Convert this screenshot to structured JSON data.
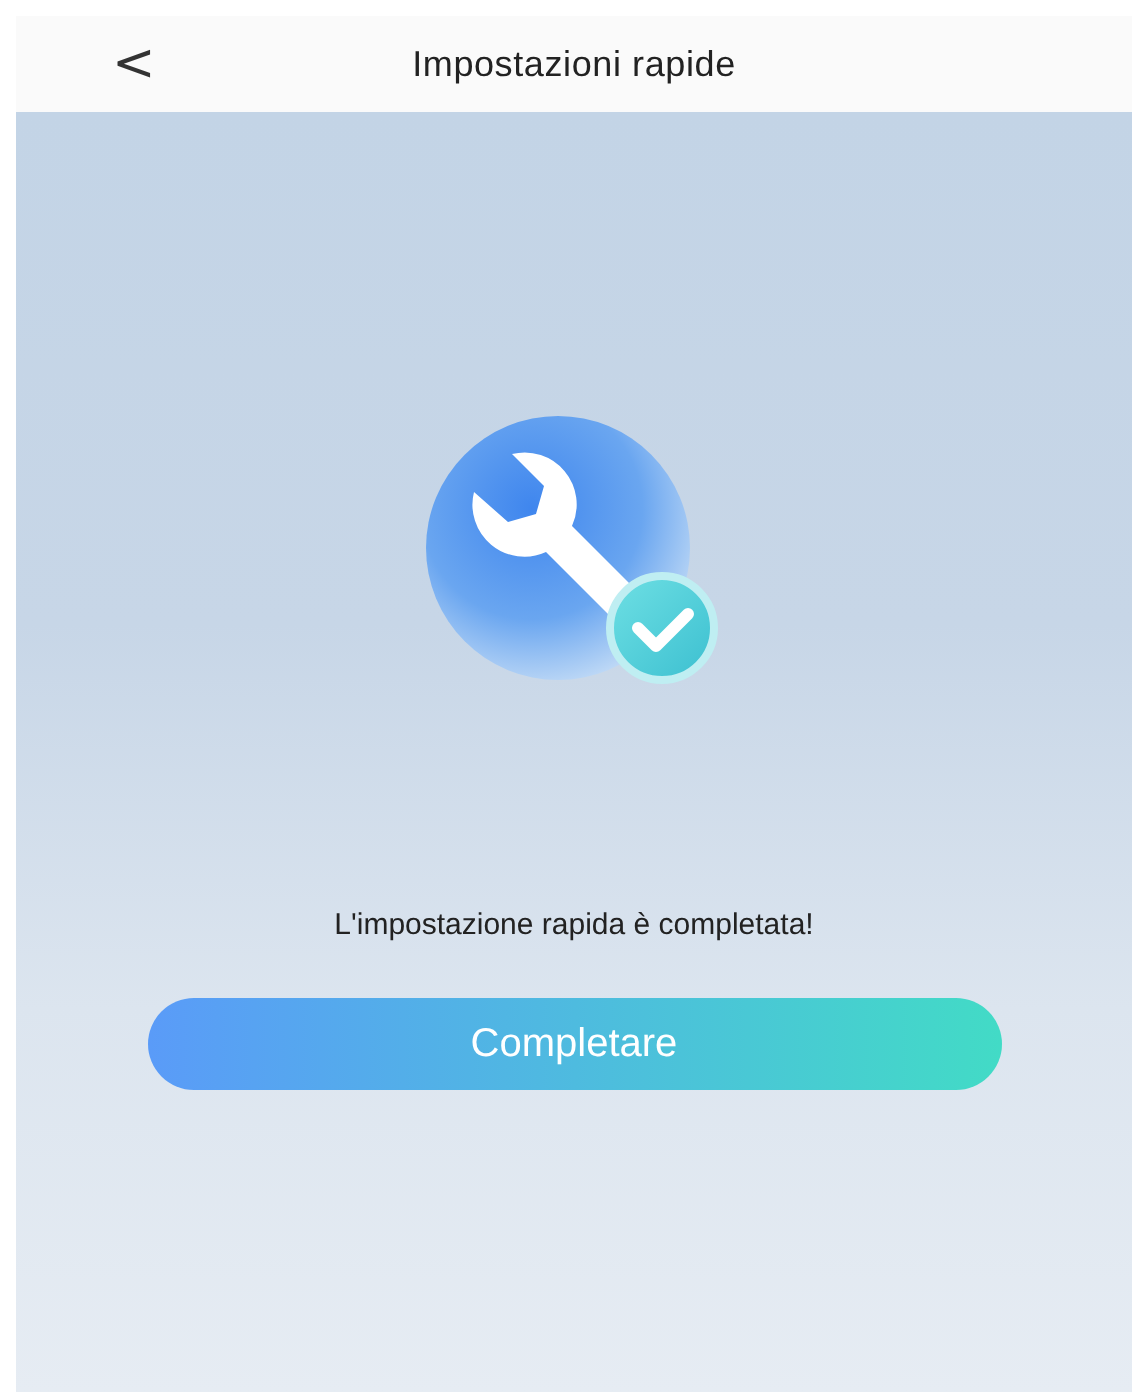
{
  "header": {
    "back": "<",
    "title": "Impostazioni rapide"
  },
  "message": "L'impostazione rapida è completata!",
  "button": "Completare"
}
